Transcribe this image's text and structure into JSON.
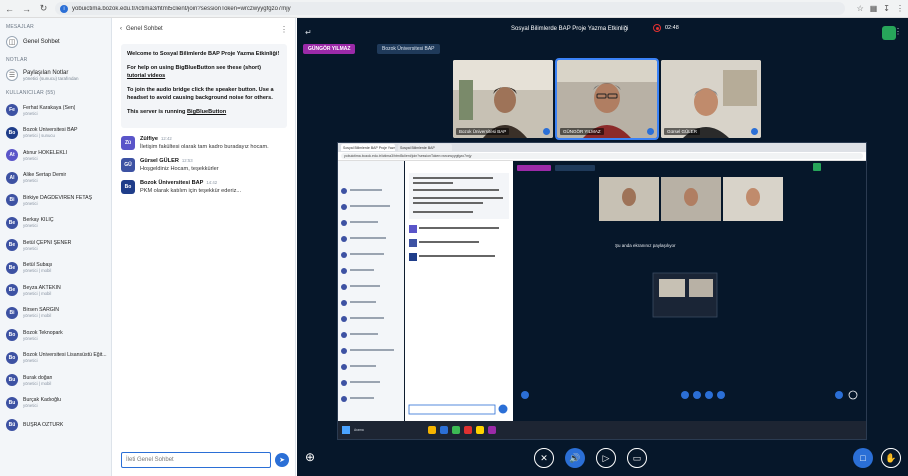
{
  "browser": {
    "url": "yobuictima.bozok.edu.tr/ictima3/html5client/join?sessionToken=wrczwyygfgzo7mjy",
    "back_icon": "arrow-left-icon",
    "forward_icon": "arrow-right-icon",
    "reload_icon": "reload-icon"
  },
  "userlist": {
    "messages_title": "MESAJLAR",
    "public_chat_label": "Genel Sohbet",
    "notes_title": "NOTLAR",
    "shared_notes_label": "Paylaşılan Notlar",
    "shared_notes_sub": "yönetici (sunucu) tarafından",
    "users_title": "KULLANICILAR (55)",
    "users": [
      {
        "initials": "Fe",
        "name": "Ferhat Karakaya (Sen)",
        "sub": "yönetici",
        "color": "#3d52a3"
      },
      {
        "initials": "Bo",
        "name": "Bozok Üniversitesi BAP",
        "sub": "yönetici | sunucu",
        "color": "#1f3d8a"
      },
      {
        "initials": "At",
        "name": "Atınur HOKELEKLİ",
        "sub": "yönetici",
        "color": "#5a55c9"
      },
      {
        "initials": "Al",
        "name": "Alike Sertap Demir",
        "sub": "yönetici",
        "color": "#3d52a3"
      },
      {
        "initials": "Bi",
        "name": "Birkiye DAĞDEVİREN FETAŞ",
        "sub": "yönetici",
        "color": "#3d52a3"
      },
      {
        "initials": "Be",
        "name": "Berkay KILIÇ",
        "sub": "yönetici",
        "color": "#3d52a3"
      },
      {
        "initials": "Be",
        "name": "Betül ÇEPNİ ŞENER",
        "sub": "yönetici",
        "color": "#3d52a3"
      },
      {
        "initials": "Be",
        "name": "Betül Subaşı",
        "sub": "yönetici | mobil",
        "color": "#3d52a3"
      },
      {
        "initials": "Be",
        "name": "Beyza AKTEKİN",
        "sub": "yönetici | mobil",
        "color": "#3d52a3"
      },
      {
        "initials": "Bi",
        "name": "Birsen SARGIN",
        "sub": "yönetici | mobil",
        "color": "#3d52a3"
      },
      {
        "initials": "Bo",
        "name": "Bozok Teknopark",
        "sub": "yönetici",
        "color": "#3d52a3"
      },
      {
        "initials": "Bo",
        "name": "Bozok Üniversitesi Lisansüstü Eğit...",
        "sub": "yönetici",
        "color": "#3d52a3"
      },
      {
        "initials": "Bu",
        "name": "Burak doğan",
        "sub": "yönetici | mobil",
        "color": "#3d52a3"
      },
      {
        "initials": "Bu",
        "name": "Burçak Kadıoğlu",
        "sub": "yönetici",
        "color": "#3d52a3"
      },
      {
        "initials": "Bü",
        "name": "BÜŞRA ÖZTÜRK",
        "sub": "",
        "color": "#3d52a3"
      }
    ]
  },
  "chat": {
    "back_label": "Genel Sohbet",
    "welcome_title": "Welcome to Sosyal Bilimlerde BAP Proje Yazma Etkinliği!",
    "welcome_help_prefix": "For help on using BigBlueButton see these (short)",
    "welcome_help_link": "tutorial videos",
    "welcome_audio": "To join the audio bridge click the speaker button. Use a headset to avoid causing background noise for others.",
    "welcome_server_prefix": "This server is running",
    "welcome_server_link": "BigBlueButton",
    "messages": [
      {
        "initials": "Zü",
        "name": "Zülfiye",
        "time": "12:42",
        "text": "İletişim fakültesi olarak tam kadro buradayız hocam.",
        "color": "#5a55c9"
      },
      {
        "initials": "GÜ",
        "name": "Gürsel GÜLER",
        "time": "12:53",
        "text": "Hoşgeldiniz Hocam, teşekkürler",
        "color": "#3d52a3"
      },
      {
        "initials": "Bo",
        "name": "Bozok Üniversitesi BAP",
        "time": "14:42",
        "text": "PKM olarak katılım için teşekkür ederiz...",
        "color": "#1f3d8a"
      }
    ],
    "input_placeholder": "İleti Genel Sohbet"
  },
  "meeting": {
    "title": "Sosyal Bilimlerde BAP Proje Yazma Etkinliği",
    "timer": "02:48",
    "presenter_tag": "GÜNGÖR YILMAZ",
    "org_tag": "Bozok Üniversitesi BAP",
    "videos": [
      {
        "label": "Bozok Üniversitesi BAP"
      },
      {
        "label": "GÜNGÖR YILMAZ"
      },
      {
        "label": "Gürsel GÜLER"
      }
    ],
    "share_caption": "Şu anda ekranınız paylaşılıyor",
    "inner_tab_1": "Sosyal Bilimlerde BAP Proje Yazma",
    "inner_tab_2": "Sosyal Bilimlerde BAP",
    "inner_url": "yobuictima.bozok.edu.tr/ictima3/html5client/join?sessionToken=wrczwyygfgzo7mjy",
    "inner_title": "Sosyal Bilimlerde BAP Proje Yazma Etkinliği",
    "inner_search": "Arama"
  },
  "colors": {
    "accent": "#2b6fd6",
    "meeting_bg": "#06172a",
    "presenter": "#9b2aa8",
    "record": "#e03131",
    "connection": "#27a55a"
  }
}
